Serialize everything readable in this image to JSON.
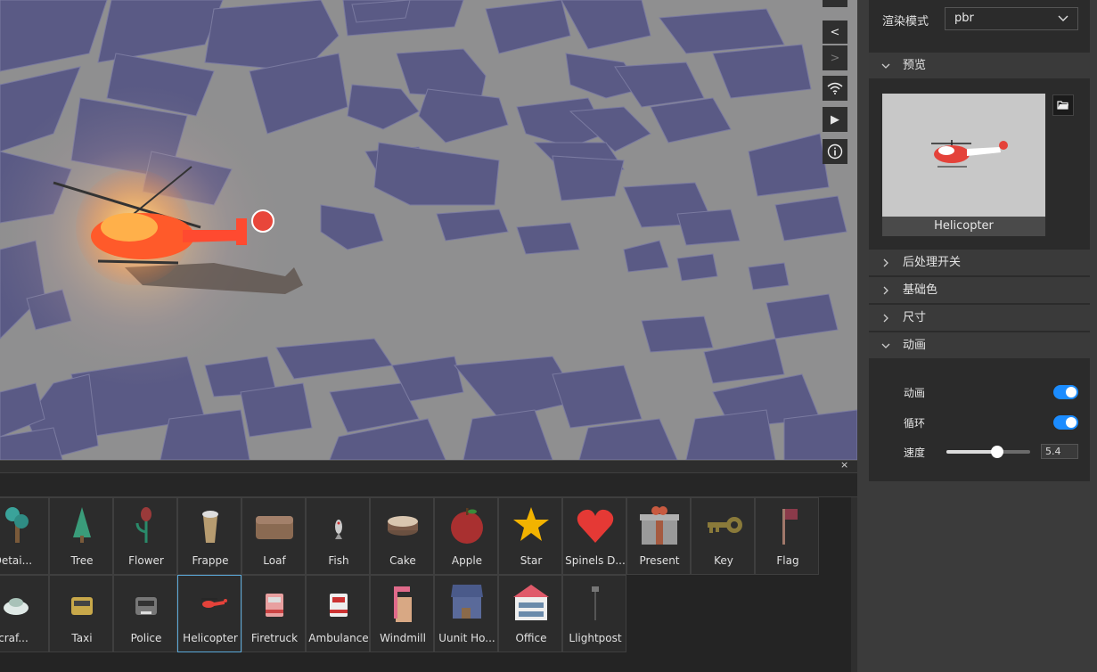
{
  "viewport": {
    "tools": [
      {
        "name": "collapse-left-icon",
        "glyph": "<"
      },
      {
        "name": "collapse-right-icon",
        "glyph": ">"
      },
      {
        "name": "wifi-icon",
        "glyph": ""
      },
      {
        "name": "play-icon",
        "glyph": "▶"
      },
      {
        "name": "info-icon",
        "glyph": "i"
      }
    ]
  },
  "panel": {
    "render_mode_label": "渲染模式",
    "render_mode_value": "pbr",
    "sections": {
      "preview": "预览",
      "post": "后处理开关",
      "base_color": "基础色",
      "size": "尺寸",
      "animation": "动画"
    },
    "preview_caption": "Helicopter",
    "animation": {
      "anim_label": "动画",
      "anim_on": true,
      "loop_label": "循环",
      "loop_on": true,
      "speed_label": "速度",
      "speed_value": "5.4",
      "speed_fraction": 0.61
    }
  },
  "assets": {
    "close_glyph": "×",
    "row1": [
      {
        "label": "ee Detai...",
        "icon": "tree-detail-icon",
        "clip": true
      },
      {
        "label": "Tree",
        "icon": "tree-icon"
      },
      {
        "label": "Flower",
        "icon": "flower-icon"
      },
      {
        "label": "Frappe",
        "icon": "frappe-icon"
      },
      {
        "label": "Loaf",
        "icon": "loaf-icon"
      },
      {
        "label": "Fish",
        "icon": "fish-icon"
      },
      {
        "label": "Cake",
        "icon": "cake-icon"
      },
      {
        "label": "Apple",
        "icon": "apple-icon"
      },
      {
        "label": "Star",
        "icon": "star-icon"
      },
      {
        "label": "Spinels D...",
        "icon": "heart-icon"
      },
      {
        "label": "Present",
        "icon": "present-icon"
      },
      {
        "label": "Key",
        "icon": "key-icon"
      },
      {
        "label": "Flag",
        "icon": "flag-icon"
      }
    ],
    "row2": [
      {
        "label": "atercraf...",
        "icon": "watercraft-icon",
        "clip": true
      },
      {
        "label": "Taxi",
        "icon": "taxi-icon"
      },
      {
        "label": "Police",
        "icon": "police-icon"
      },
      {
        "label": "Helicopter",
        "icon": "helicopter-icon",
        "selected": true
      },
      {
        "label": "Firetruck",
        "icon": "firetruck-icon"
      },
      {
        "label": "Ambulance",
        "icon": "ambulance-icon"
      },
      {
        "label": "Windmill",
        "icon": "windmill-icon"
      },
      {
        "label": "Uunit Ho...",
        "icon": "house-icon"
      },
      {
        "label": "Office",
        "icon": "office-icon"
      },
      {
        "label": "Llightpost",
        "icon": "lightpost-icon"
      }
    ]
  },
  "colors": {
    "toggle_on": "#1b8cff",
    "building": "#5a5a85",
    "ground": "#8e8e8e",
    "selection": "#5aa8d8"
  }
}
